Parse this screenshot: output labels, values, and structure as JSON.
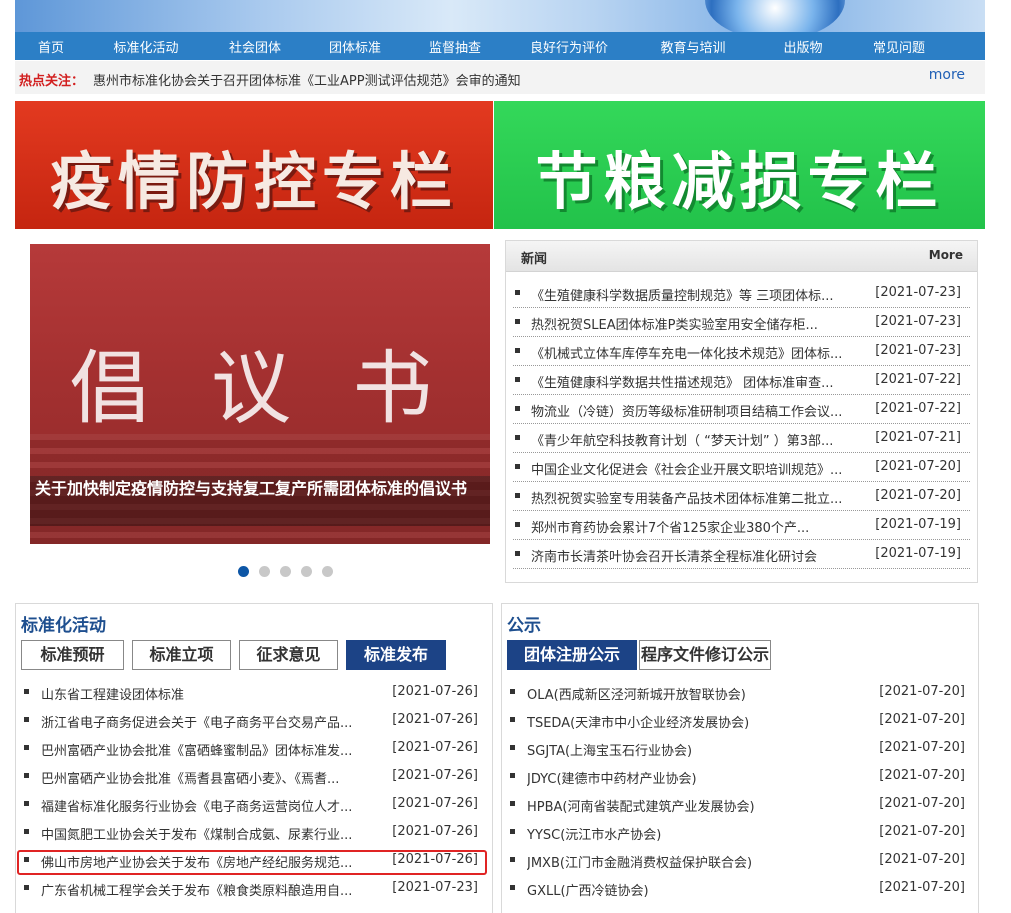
{
  "nav": [
    "首页",
    "标准化活动",
    "社会团体",
    "团体标准",
    "监督抽查",
    "良好行为评价",
    "教育与培训",
    "出版物",
    "常见问题"
  ],
  "hot": {
    "label": "热点关注：",
    "text": "惠州市标准化协会关于召开团体标准《工业APP测试评估规范》会审的通知",
    "more": "more"
  },
  "promos": {
    "red": "疫情防控专栏",
    "green": "节粮减损专栏"
  },
  "slide": {
    "headline": "倡 议 书",
    "caption": "关于加快制定疫情防控与支持复工复产所需团体标准的倡议书",
    "dots": 5,
    "active_dot": 0
  },
  "news": {
    "title": "新闻",
    "more": "More",
    "items": [
      {
        "title": "《生殖健康科学数据质量控制规范》等 三项团体标...",
        "date": "[2021-07-23]"
      },
      {
        "title": "热烈祝贺SLEA团体标准P类实验室用安全储存柜...",
        "date": "[2021-07-23]"
      },
      {
        "title": "《机械式立体车库停车充电一体化技术规范》团体标...",
        "date": "[2021-07-23]"
      },
      {
        "title": "《生殖健康科学数据共性描述规范》 团体标准审查...",
        "date": "[2021-07-22]"
      },
      {
        "title": "物流业（冷链）资历等级标准研制项目结稿工作会议...",
        "date": "[2021-07-22]"
      },
      {
        "title": "《青少年航空科技教育计划（ “梦天计划” ）第3部...",
        "date": "[2021-07-21]"
      },
      {
        "title": "中国企业文化促进会《社会企业开展文职培训规范》...",
        "date": "[2021-07-20]"
      },
      {
        "title": "热烈祝贺实验室专用装备产品技术团体标准第二批立...",
        "date": "[2021-07-20]"
      },
      {
        "title": "郑州市育药协会累计7个省125家企业380个产...",
        "date": "[2021-07-19]"
      },
      {
        "title": "济南市长清茶叶协会召开长清茶全程标准化研讨会",
        "date": "[2021-07-19]"
      }
    ]
  },
  "activities": {
    "title": "标准化活动",
    "tabs": [
      "标准预研",
      "标准立项",
      "征求意见",
      "标准发布"
    ],
    "active_tab": 3,
    "items": [
      {
        "title": "山东省工程建设团体标准",
        "date": "[2021-07-26]"
      },
      {
        "title": "浙江省电子商务促进会关于《电子商务平台交易产品...",
        "date": "[2021-07-26]"
      },
      {
        "title": "巴州富硒产业协会批准《富硒蜂蜜制品》团体标准发...",
        "date": "[2021-07-26]"
      },
      {
        "title": "巴州富硒产业协会批准《焉耆县富硒小麦》、《焉耆...",
        "date": "[2021-07-26]"
      },
      {
        "title": "福建省标准化服务行业协会《电子商务运营岗位人才...",
        "date": "[2021-07-26]"
      },
      {
        "title": "中国氮肥工业协会关于发布《煤制合成氨、尿素行业...",
        "date": "[2021-07-26]"
      },
      {
        "title": "佛山市房地产业协会关于发布《房地产经纪服务规范...",
        "date": "[2021-07-26]"
      },
      {
        "title": "广东省机械工程学会关于发布《粮食类原料酿造用自...",
        "date": "[2021-07-23]"
      }
    ]
  },
  "notices": {
    "title": "公示",
    "tabs": [
      "团体注册公示",
      "程序文件修订公示"
    ],
    "active_tab": 0,
    "items": [
      {
        "title": "OLA(西咸新区泾河新城开放智联协会)",
        "date": "[2021-07-20]"
      },
      {
        "title": "TSEDA(天津市中小企业经济发展协会)",
        "date": "[2021-07-20]"
      },
      {
        "title": "SGJTA(上海宝玉石行业协会)",
        "date": "[2021-07-20]"
      },
      {
        "title": "JDYC(建德市中药材产业协会)",
        "date": "[2021-07-20]"
      },
      {
        "title": "HPBA(河南省装配式建筑产业发展协会)",
        "date": "[2021-07-20]"
      },
      {
        "title": "YYSC(沅江市水产协会)",
        "date": "[2021-07-20]"
      },
      {
        "title": "JMXB(江门市金融消费权益保护联合会)",
        "date": "[2021-07-20]"
      },
      {
        "title": "GXLL(广西冷链协会)",
        "date": "[2021-07-20]"
      }
    ]
  }
}
